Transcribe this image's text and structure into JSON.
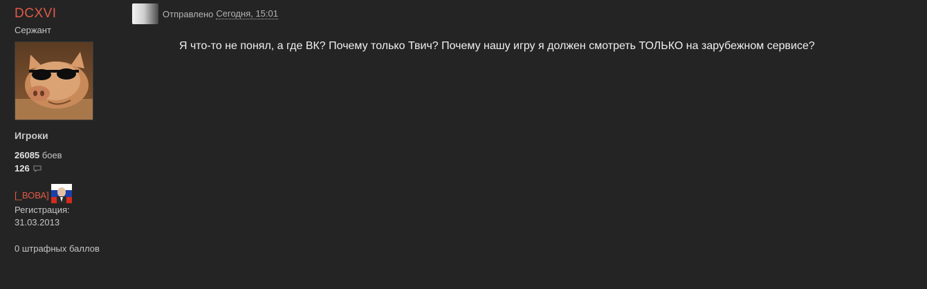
{
  "author": {
    "username": "DCXVI",
    "rank": "Сержант",
    "avatar_icon": "pig-with-sunglasses-avatar",
    "group": "Игроки",
    "battles_count": "26085",
    "battles_label": "боев",
    "posts_count": "126",
    "clan_tag": "[_ВОВА]",
    "registration_label": "Регистрация:",
    "registration_date": "31.03.2013",
    "penalty_text": "0 штрафных баллов"
  },
  "post": {
    "sent_label": "Отправлено",
    "date": "Сегодня, 15:01",
    "body": "Я что-то не понял, а где ВК? Почему только Твич? Почему нашу игру я должен смотреть ТОЛЬКО на зарубежном сервисе?"
  },
  "colors": {
    "background": "#242424",
    "username": "#e05a48",
    "text": "#c6c6c6"
  }
}
